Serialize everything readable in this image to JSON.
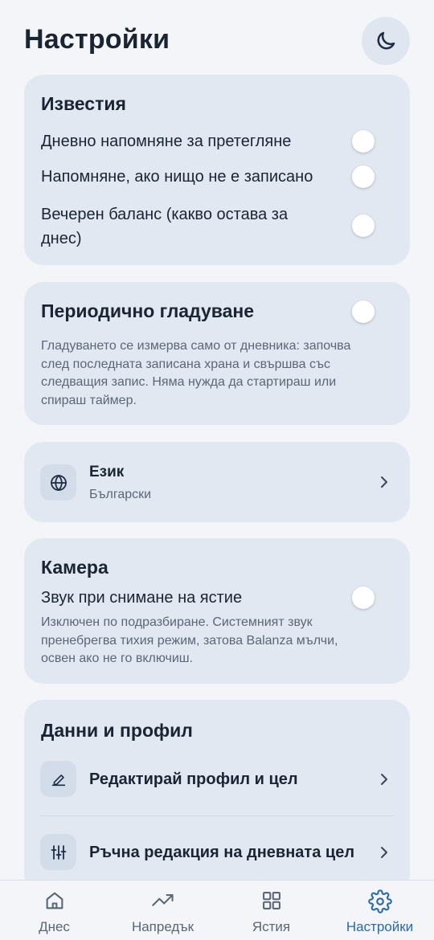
{
  "header": {
    "title": "Настройки",
    "theme_toggle_icon": "moon-icon"
  },
  "notifications": {
    "title": "Известия",
    "items": [
      {
        "label": "Дневно напомняне за претегляне",
        "enabled": false
      },
      {
        "label": "Напомняне, ако нищо не е записано",
        "enabled": false
      },
      {
        "label_line1": "Вечерен баланс (какво остава за",
        "label_line2": "днес)",
        "enabled": false
      }
    ]
  },
  "fasting": {
    "title": "Периодично гладуване",
    "enabled": false,
    "description_lines": [
      "Гладуването се измерва само от дневника: започва",
      "след последната записана храна и свършва със",
      "следващия запис. Няма нужда да стартираш или",
      "спираш таймер."
    ]
  },
  "language": {
    "icon": "globe-icon",
    "title": "Език",
    "value": "Български"
  },
  "camera": {
    "title": "Камера",
    "shutter_label": "Звук при снимане на ястие",
    "enabled": false,
    "description_lines": [
      "Изключен по подразбиране. Системният звук",
      "пренебрегва тихия режим, затова Balanza мълчи,",
      "освен ако не го включиш."
    ]
  },
  "data_profile": {
    "title": "Данни и профил",
    "items": [
      {
        "icon": "pencil-icon",
        "label": "Редактирай профил и цел"
      },
      {
        "icon": "sliders-icon",
        "label": "Ръчна редакция на дневната цел"
      }
    ]
  },
  "bottom_nav": {
    "active": "Настройки",
    "accent_color": "#2a6aa8",
    "items": [
      {
        "icon": "home-icon",
        "label": "Днес"
      },
      {
        "icon": "trend-icon",
        "label": "Напредък"
      },
      {
        "icon": "grid-icon",
        "label": "Ястия"
      },
      {
        "icon": "gear-icon",
        "label": "Настройки"
      }
    ]
  }
}
